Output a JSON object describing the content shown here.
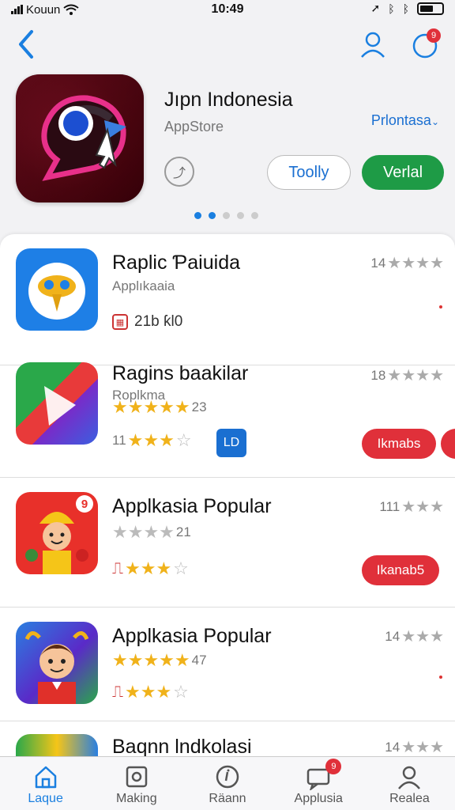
{
  "status_bar": {
    "carrier": "Kouun",
    "time": "10:49"
  },
  "header": {
    "notification_badge": "9"
  },
  "featured": {
    "title": "Jıpn Indonesia",
    "subtitle": "AppStore",
    "link": "Prlontasa",
    "button_outline": "Toolly",
    "button_primary": "Verlal",
    "page_dots": {
      "count": 5,
      "active": [
        0,
        1
      ]
    }
  },
  "apps": [
    {
      "name": "Raplic Ƥaiuida",
      "category": "Applıkaaia",
      "rating_text": "14",
      "meta_text": "21b ƙl0",
      "icon": "owl-icon"
    },
    {
      "name": "Ragins baakilar",
      "category": "Roplkma",
      "rating_text": "18",
      "stars_text": "23",
      "count_text": "11",
      "badge": "LD",
      "action": "Ikmabs",
      "icon": "play-icon"
    },
    {
      "name": "Applkasia Popular",
      "rating_text": "111",
      "stars_text": "21",
      "action": "Ikanab5",
      "icon_badge": "9",
      "icon": "worker-character-icon"
    },
    {
      "name": "Applkasia Popular",
      "rating_text": "14",
      "stars_text": "47",
      "icon": "boy-character-icon"
    },
    {
      "name": "Baqnn lndkolasi",
      "rating_text": "14",
      "icon": "colorful-app-icon"
    }
  ],
  "tabs": [
    {
      "label": "Laque",
      "icon": "home-icon",
      "active": true
    },
    {
      "label": "Making",
      "icon": "square-icon"
    },
    {
      "label": "Räann",
      "icon": "info-icon"
    },
    {
      "label": "Applusia",
      "icon": "chat-icon",
      "badge": "9"
    },
    {
      "label": "Realea",
      "icon": "profile-icon"
    }
  ],
  "colors": {
    "accent": "#1a7fe0",
    "green": "#1e9b46",
    "red": "#e0303a",
    "star": "#f0b21a"
  }
}
